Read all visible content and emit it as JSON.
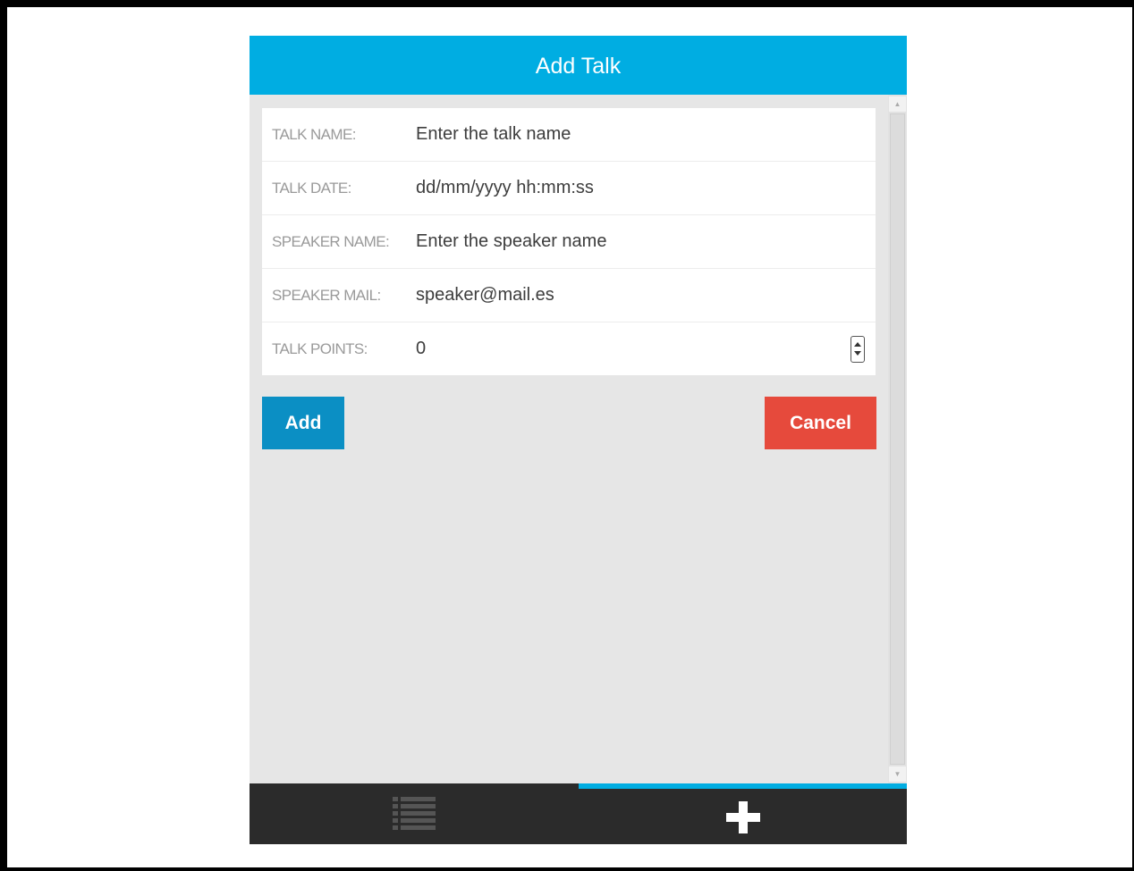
{
  "header": {
    "title": "Add Talk"
  },
  "form": {
    "rows": [
      {
        "label": "TALK NAME:",
        "value": "Enter the talk name"
      },
      {
        "label": "TALK DATE:",
        "value": "dd/mm/yyyy hh:mm:ss"
      },
      {
        "label": "SPEAKER NAME:",
        "value": "Enter the speaker name"
      },
      {
        "label": "SPEAKER MAIL:",
        "value": "speaker@mail.es"
      },
      {
        "label": "TALK POINTS:",
        "value": "0"
      }
    ]
  },
  "buttons": {
    "add": "Add",
    "cancel": "Cancel"
  },
  "tabs": [
    {
      "icon": "list-icon",
      "active": false
    },
    {
      "icon": "plus-icon",
      "active": true
    }
  ],
  "colors": {
    "header": "#00ade2",
    "add_button": "#0b8fc4",
    "cancel_button": "#e64a3c",
    "tabbar": "#2b2b2b",
    "active_tab_indicator": "#00ade2"
  }
}
